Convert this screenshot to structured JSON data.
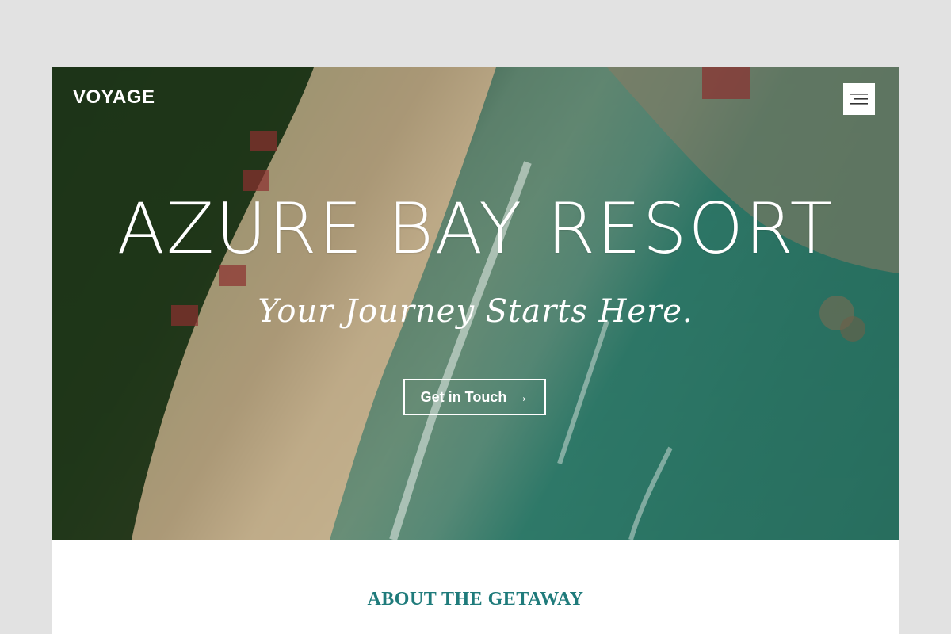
{
  "header": {
    "brand": "VOYAGE",
    "menu_icon": "hamburger-icon"
  },
  "hero": {
    "title": "AZURE BAY RESORT",
    "tagline": "Your Journey Starts Here.",
    "cta_label": "Get in Touch",
    "cta_icon": "arrow-right-icon"
  },
  "about": {
    "label": "ABOUT THE GETAWAY"
  },
  "colors": {
    "accent": "#1f7b7b",
    "page_bg": "#e2e2e2",
    "sea": "#2f7f6e",
    "sand": "#d8c6a3"
  }
}
